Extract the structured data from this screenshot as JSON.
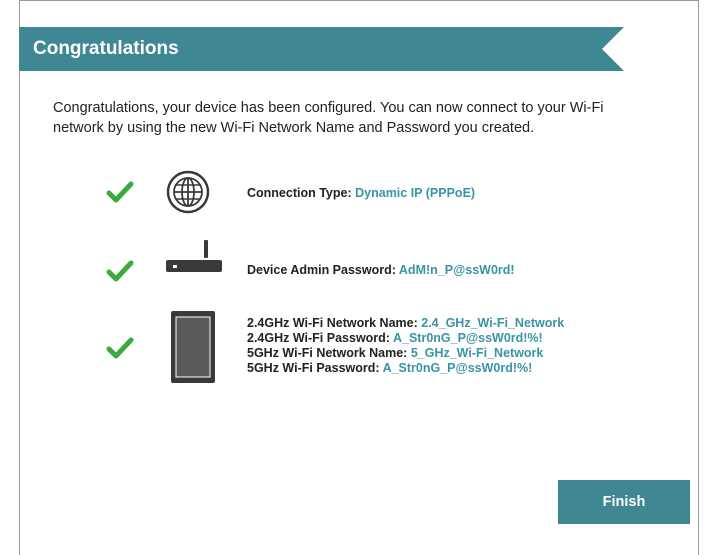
{
  "header": {
    "title": "Congratulations"
  },
  "intro": {
    "line1": "Congratulations, your device has been configured. You can now connect to your Wi-Fi",
    "line2": "network by using the new Wi-Fi Network Name and Password you created."
  },
  "connection": {
    "label": "Connection Type:",
    "value": "Dynamic IP (PPPoE)"
  },
  "admin": {
    "label": "Device Admin Password:",
    "value": "AdM!n_P@ssW0rd!"
  },
  "wifi": {
    "ssid24_label": "2.4GHz Wi-Fi Network Name:",
    "ssid24_value": "2.4_GHz_Wi-Fi_Network",
    "pass24_label": "2.4GHz Wi-Fi Password:",
    "pass24_value": "A_Str0nG_P@ssW0rd!%!",
    "ssid5_label": "5GHz Wi-Fi Network Name:",
    "ssid5_value": "5_GHz_Wi-Fi_Network",
    "pass5_label": "5GHz Wi-Fi Password:",
    "pass5_value": "A_Str0nG_P@ssW0rd!%!"
  },
  "footer": {
    "finish_label": "Finish"
  },
  "icons": {
    "check": "checkmark-icon",
    "globe": "globe-icon",
    "router": "router-icon",
    "tablet": "tablet-icon"
  },
  "colors": {
    "banner": "#3f8792",
    "value_text": "#3a94a6",
    "check": "#3caa3c",
    "icon_dark": "#3a3a3a",
    "button": "#3f8792"
  }
}
